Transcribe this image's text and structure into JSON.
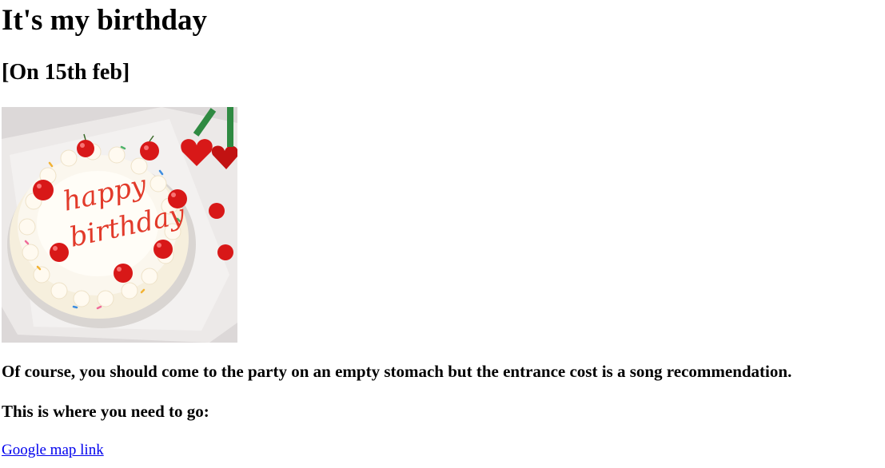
{
  "heading": "It's my birthday",
  "subheading": "[On 15th feb]",
  "image": {
    "cake_text_line1": "happy",
    "cake_text_line2": "birthday"
  },
  "paragraphs": {
    "invite": "Of course, you should come to the party on an empty stomach but the entrance cost is a song recommendation.",
    "directions": "This is where you need to go:"
  },
  "link": {
    "label": "Google map link"
  },
  "colors": {
    "link": "#0000ee",
    "text": "#000000",
    "cherry": "#d81818",
    "icing_text": "#e23a2a"
  }
}
